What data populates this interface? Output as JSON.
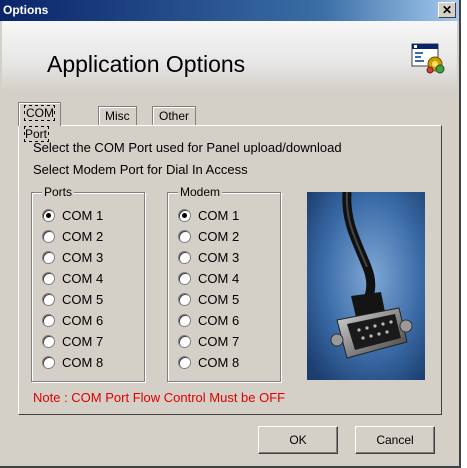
{
  "window": {
    "title": "Options",
    "close_label": "✕"
  },
  "header": {
    "title": "Application Options",
    "icon": "options-app-icon"
  },
  "tabs": [
    {
      "label": "COM Port",
      "active": true
    },
    {
      "label": "Misc",
      "active": false
    },
    {
      "label": "Other",
      "active": false
    }
  ],
  "panel": {
    "line1": "Select the COM Port used for Panel upload/download",
    "line2": "Select Modem Port for Dial In Access",
    "ports": {
      "label": "Ports",
      "selected": "COM 1",
      "options": [
        "COM 1",
        "COM 2",
        "COM 3",
        "COM 4",
        "COM 5",
        "COM 6",
        "COM 7",
        "COM 8"
      ]
    },
    "modem": {
      "label": "Modem",
      "selected": "COM 1",
      "options": [
        "COM 1",
        "COM 2",
        "COM 3",
        "COM 4",
        "COM 5",
        "COM 6",
        "COM 7",
        "COM 8"
      ]
    },
    "image": "serial-cable-photo",
    "note": "Note : COM Port Flow Control Must be OFF"
  },
  "buttons": {
    "ok": "OK",
    "cancel": "Cancel"
  },
  "colors": {
    "titlebar": "#0a246a",
    "note": "#e00000",
    "face": "#d4d0c8"
  }
}
